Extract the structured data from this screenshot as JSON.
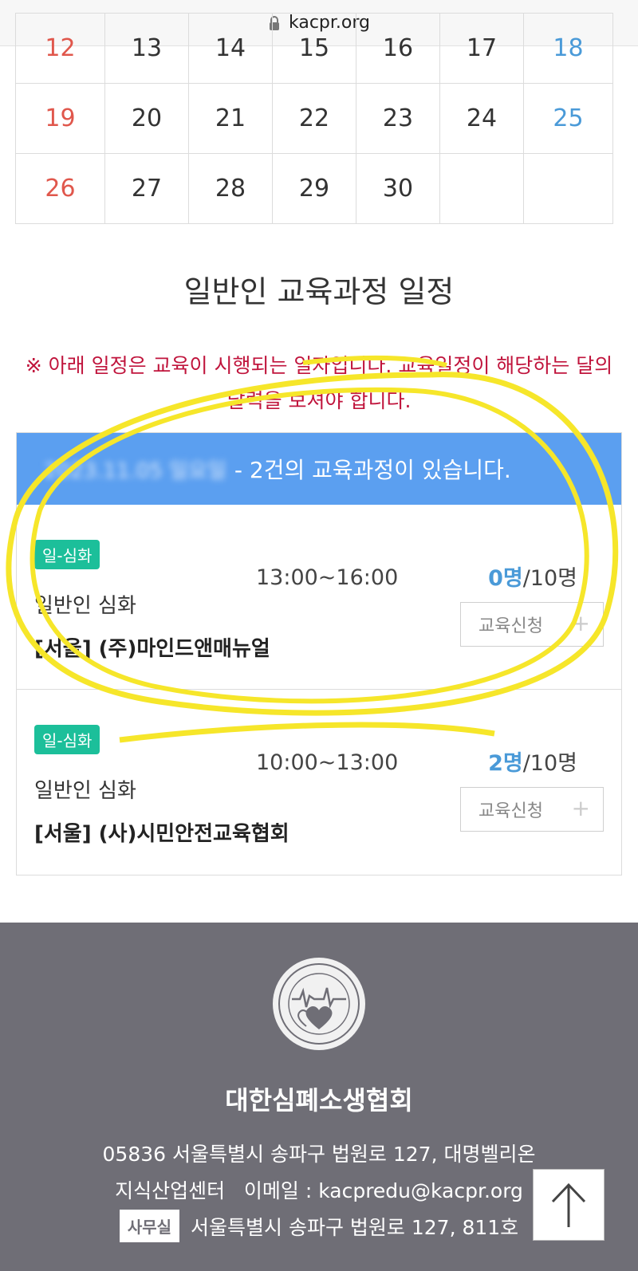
{
  "browser": {
    "url": "kacpr.org"
  },
  "calendar": {
    "rows": [
      [
        "12",
        "13",
        "14",
        "15",
        "16",
        "17",
        "18"
      ],
      [
        "19",
        "20",
        "21",
        "22",
        "23",
        "24",
        "25"
      ],
      [
        "26",
        "27",
        "28",
        "29",
        "30",
        "",
        ""
      ]
    ],
    "colors": {
      "sunday": "#e0574c",
      "saturday": "#4a9ad8"
    }
  },
  "section": {
    "title": "일반인 교육과정 일정",
    "notice": "※ 아래 일정은 교육이 시행되는 일자입니다. 교육일정이 해당하는 달의 달력을 보셔야 합니다."
  },
  "schedule": {
    "date_label": "2023.11.05 일요일",
    "count_text": "- 2건의 교육과정이 있습니다.",
    "courses": [
      {
        "badge": "일-심화",
        "type": "일반인 심화",
        "place": "[서울] (주)마인드앤매뉴얼",
        "time": "13:00~16:00",
        "enrolled": "0명",
        "capacity": "/10명",
        "apply_label": "교육신청"
      },
      {
        "badge": "일-심화",
        "type": "일반인 심화",
        "place": "[서울] (사)시민안전교육협회",
        "time": "10:00~13:00",
        "enrolled": "2명",
        "capacity": "/10명",
        "apply_label": "교육신청"
      }
    ]
  },
  "footer": {
    "org_name": "대한심폐소생협회",
    "address_line1": "05836 서울특별시 송파구 법원로 127, 대명벨리온",
    "address_line2": "지식산업센터   이메일 : kacpredu@kacpr.org",
    "office_label": "사무실",
    "office_address": "서울특별시 송파구 법원로 127, 811호",
    "logo_text": "Korean Association of Cardiopulmonary Resuscitation 대한심폐소생협회"
  },
  "accent": {
    "header_blue": "#5b9ff0",
    "badge_green": "#1cbf9a",
    "notice_red": "#c0143c",
    "footer_gray": "#6f6e76"
  }
}
